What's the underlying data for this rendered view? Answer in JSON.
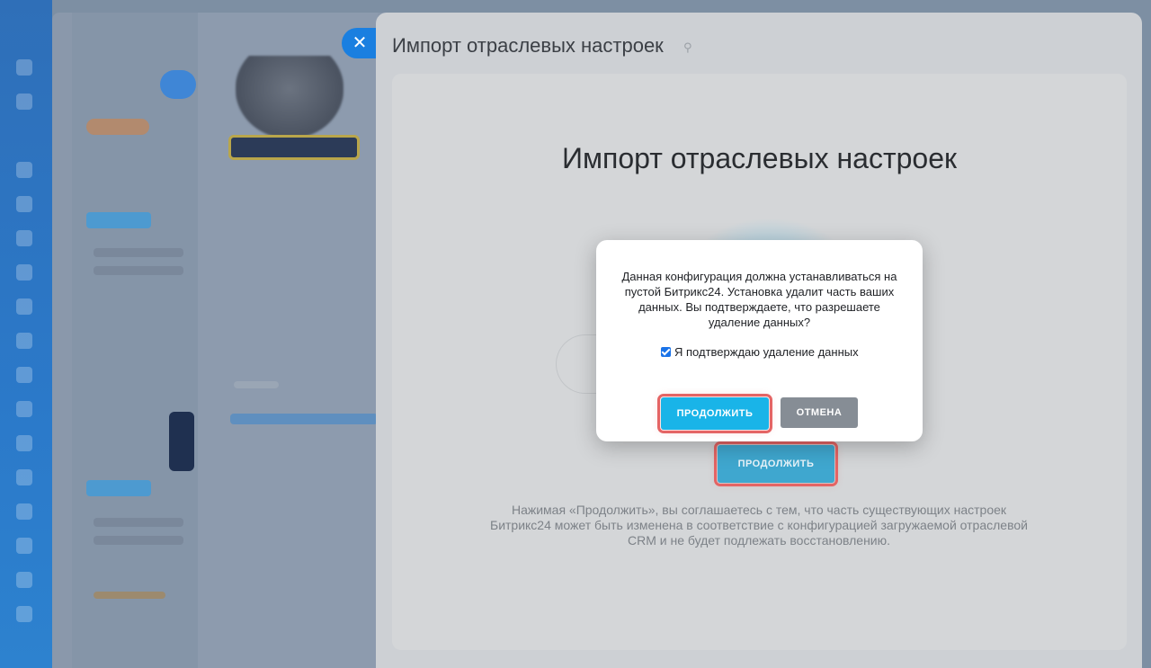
{
  "slider": {
    "title": "Импорт отраслевых настроек",
    "close_icon": "close-icon",
    "pin_icon": "pin-icon"
  },
  "content": {
    "heading": "Импорт отраслевых настроек",
    "continue_label": "ПРОДОЛЖИТЬ",
    "disclaimer": "Нажимая «Продолжить», вы соглашаетесь с тем, что часть существующих настроек Битрикс24 может быть изменена в соответствие с конфигурацией загружаемой отраслевой CRM и не будет подлежать восстановлению."
  },
  "dialog": {
    "message": "Данная конфигурация должна устанавливаться на пустой Битрикс24. Установка удалит часть ваших данных. Вы подтверждаете, что разрешаете удаление данных?",
    "checkbox_label": "Я подтверждаю удаление данных",
    "checkbox_checked": true,
    "continue_label": "ПРОДОЛЖИТЬ",
    "cancel_label": "ОТМЕНА"
  },
  "colors": {
    "accent": "#19b4e8",
    "highlight": "#e46464",
    "cancel": "#868d95"
  }
}
